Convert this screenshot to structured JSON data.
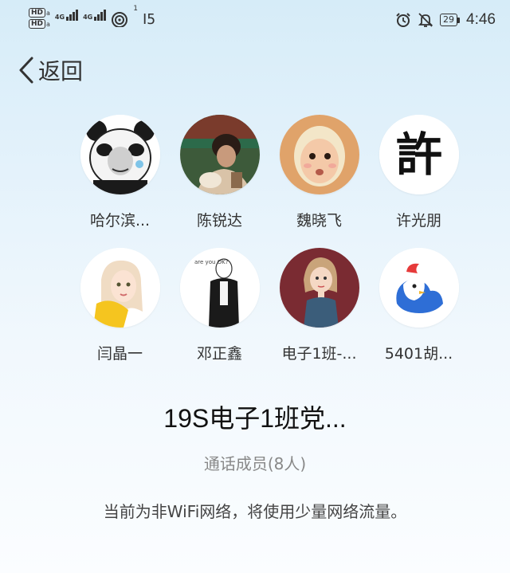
{
  "status_bar": {
    "hd_label": "HD",
    "network_label": "4G",
    "wifi_badge": "1",
    "battery_level": "29",
    "time": "4:46",
    "icons": [
      "hd-icon",
      "signal-icon",
      "wifi-icon",
      "sim-icon",
      "alarm-icon",
      "mute-icon",
      "battery-icon"
    ]
  },
  "nav": {
    "back_label": "返回",
    "back_icon": "chevron-left-icon"
  },
  "members": [
    {
      "name": "哈尔滨..."
    },
    {
      "name": "陈锐达"
    },
    {
      "name": "魏晓飞"
    },
    {
      "name": "许光朋"
    },
    {
      "name": "闫晶一"
    },
    {
      "name": "邓正鑫"
    },
    {
      "name": "电子1班-..."
    },
    {
      "name": "5401胡..."
    }
  ],
  "call": {
    "title": "19S电子1班党...",
    "member_count": "通话成员(8人)",
    "notice": "当前为非WiFi网络，将使用少量网络流量。"
  }
}
